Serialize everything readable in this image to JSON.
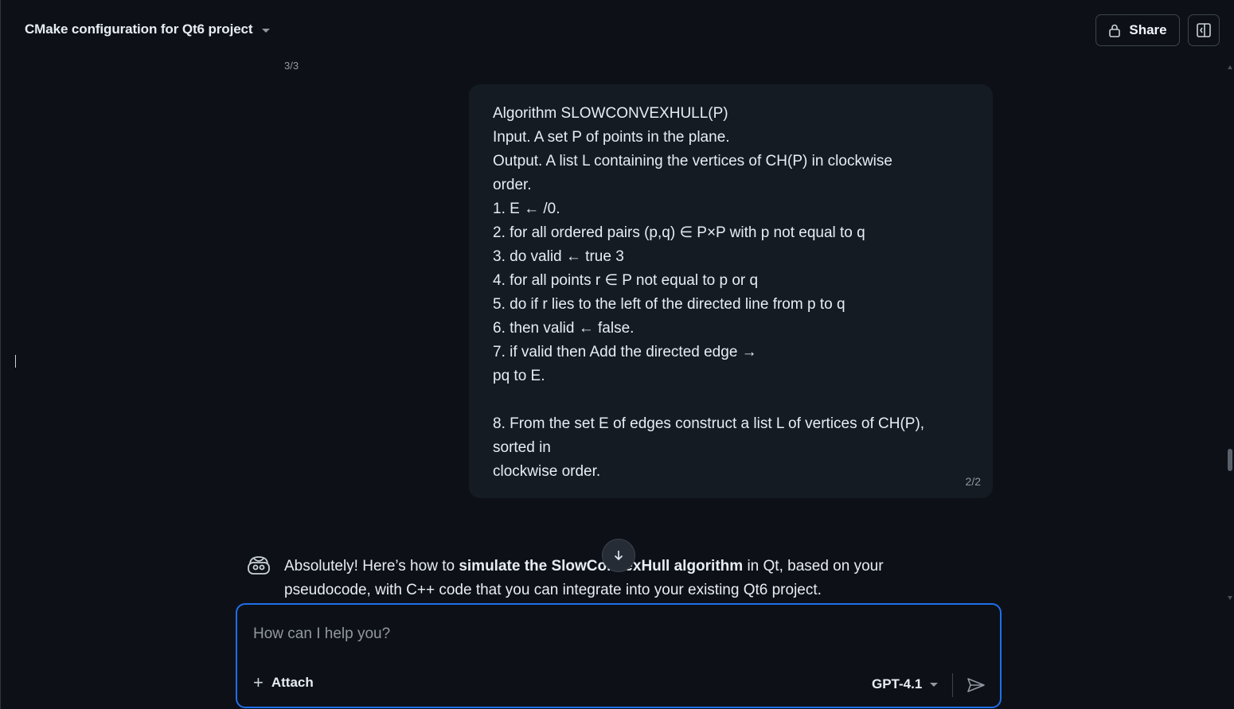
{
  "header": {
    "title": "CMake configuration for Qt6 project",
    "share_label": "Share"
  },
  "conversation": {
    "prev_counter": "3/3",
    "user_message": {
      "lines": [
        "Algorithm SLOWCONVEXHULL(P)",
        "Input. A set P of points in the plane.",
        "Output. A list L containing the vertices of CH(P) in clockwise",
        "order.",
        "1. E ← /0.",
        "2. for all ordered pairs (p,q) ∈ P×P with p not equal to q",
        "3. do valid ← true 3",
        "4. for all points r ∈ P not equal to p or q",
        "5. do if r lies to the left of the directed line from p to q",
        "6. then valid ← false.",
        "7. if valid then Add the directed edge →",
        "pq to E.",
        "",
        "8. From the set E of edges construct a list L of vertices of CH(P),",
        "sorted in",
        "clockwise order."
      ],
      "counter": "2/2"
    },
    "assistant_message": {
      "text_1": "Absolutely! Here’s how to ",
      "bold": "simulate the SlowConvexHull algorithm",
      "text_2": " in Qt, based on your pseudocode, with C++ code that you can integrate into your existing Qt6 project."
    }
  },
  "composer": {
    "placeholder": "How can I help you?",
    "attach_label": "Attach",
    "model_label": "GPT-4.1"
  },
  "icons": {
    "share": "lock-icon",
    "panel": "sidebar-toggle-icon",
    "scroll": "arrow-down-icon",
    "assistant": "copilot-icon",
    "send": "send-icon"
  },
  "colors": {
    "background": "#0d1117",
    "bubble": "#151b23",
    "accent": "#1f6feb",
    "muted_text": "#9198a1"
  }
}
